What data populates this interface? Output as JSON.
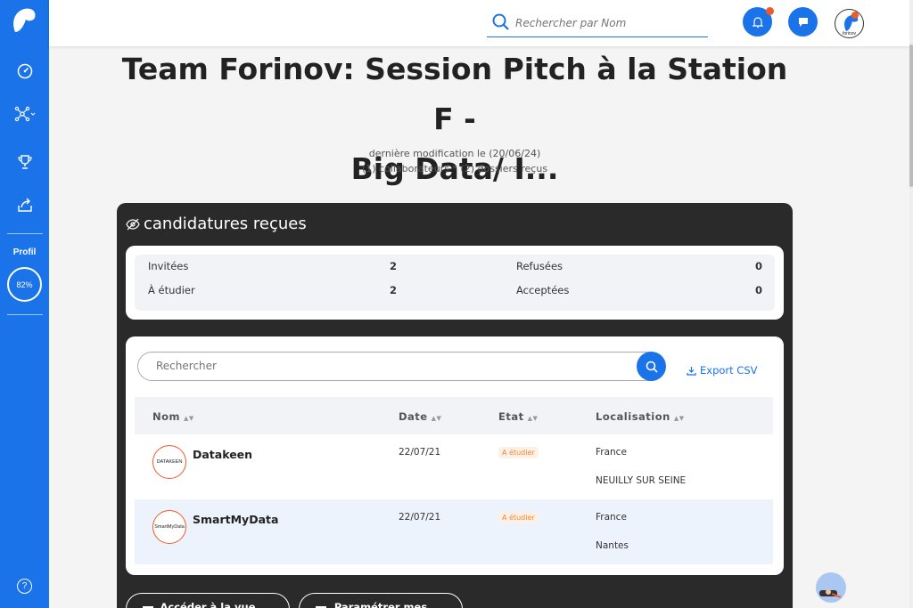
{
  "sidebar": {
    "profil_label": "Profil",
    "profil_progress": "82%",
    "icons": [
      "dashboard-icon",
      "network-icon",
      "trophy-icon",
      "share-icon",
      "help-icon"
    ],
    "help_label": "?"
  },
  "header": {
    "search_placeholder": "Rechercher par Nom",
    "avatar_label": "forinov"
  },
  "page": {
    "title_line1": "Team Forinov: Session Pitch à la Station F -",
    "title_line2": "Big Data/ I...",
    "last_modified": "dernière modification le (20/06/24)",
    "collab_info": "(1) collaborateurs * (2) dossiers reçus"
  },
  "applications": {
    "title": "candidatures reçues",
    "stats": {
      "invitees_label": "Invitées",
      "invitees_value": "2",
      "refusees_label": "Refusées",
      "refusees_value": "0",
      "a_etudier_label": "À étudier",
      "a_etudier_value": "2",
      "acceptees_label": "Acceptées",
      "acceptees_value": "0"
    },
    "search_placeholder": "Rechercher",
    "export_label": "Export CSV",
    "columns": [
      "Nom",
      "Date",
      "Etat",
      "Localisation"
    ],
    "rows": [
      {
        "logo": "DATAKEEN",
        "name": "Datakeen",
        "date": "22/07/21",
        "status": "A étudier",
        "country": "France",
        "city": "NEUILLY SUR SEINE"
      },
      {
        "logo": "SmartMyData",
        "name": "SmartMyData",
        "date": "22/07/21",
        "status": "A étudier",
        "country": "France",
        "city": "Nantes"
      }
    ],
    "bottom_buttons": [
      "Accéder à la vue",
      "Paramétrer mes"
    ]
  },
  "colors": {
    "primary": "#1a73e8",
    "accent": "#f05a28",
    "dark": "#2a2a2a"
  }
}
